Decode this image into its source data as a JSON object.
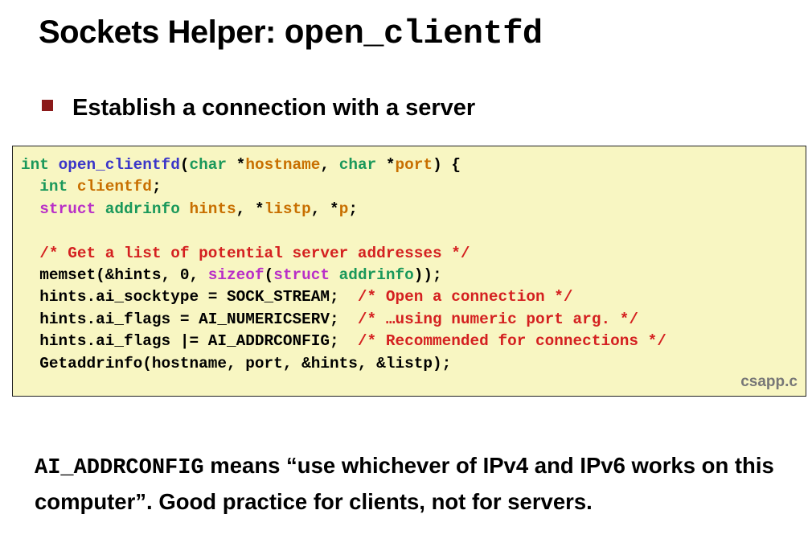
{
  "title": {
    "text": "Sockets Helper: ",
    "code": "open_clientfd"
  },
  "bullet": {
    "text": "Establish a connection with a server"
  },
  "code": {
    "filename": "csapp.c",
    "lines": [
      [
        {
          "t": "int",
          "c": "kw"
        },
        {
          "t": " ",
          "c": "pl"
        },
        {
          "t": "open_clientfd",
          "c": "fn"
        },
        {
          "t": "(",
          "c": "pl"
        },
        {
          "t": "char",
          "c": "kw"
        },
        {
          "t": " *",
          "c": "pl"
        },
        {
          "t": "hostname",
          "c": "var"
        },
        {
          "t": ", ",
          "c": "pl"
        },
        {
          "t": "char",
          "c": "kw"
        },
        {
          "t": " *",
          "c": "pl"
        },
        {
          "t": "port",
          "c": "var"
        },
        {
          "t": ") {",
          "c": "pl"
        }
      ],
      [
        {
          "t": "  ",
          "c": "pl"
        },
        {
          "t": "int",
          "c": "kw"
        },
        {
          "t": " ",
          "c": "pl"
        },
        {
          "t": "clientfd",
          "c": "var"
        },
        {
          "t": ";",
          "c": "pl"
        }
      ],
      [
        {
          "t": "  ",
          "c": "pl"
        },
        {
          "t": "struct",
          "c": "kwp"
        },
        {
          "t": " ",
          "c": "pl"
        },
        {
          "t": "addrinfo",
          "c": "kw"
        },
        {
          "t": " ",
          "c": "pl"
        },
        {
          "t": "hints",
          "c": "var"
        },
        {
          "t": ", *",
          "c": "pl"
        },
        {
          "t": "listp",
          "c": "var"
        },
        {
          "t": ", *",
          "c": "pl"
        },
        {
          "t": "p",
          "c": "var"
        },
        {
          "t": ";",
          "c": "pl"
        }
      ],
      [],
      [
        {
          "t": "  ",
          "c": "pl"
        },
        {
          "t": "/* Get a list of potential server addresses */",
          "c": "cm"
        }
      ],
      [
        {
          "t": "  memset(&hints, 0, ",
          "c": "pl"
        },
        {
          "t": "sizeof",
          "c": "kwp"
        },
        {
          "t": "(",
          "c": "pl"
        },
        {
          "t": "struct",
          "c": "kwp"
        },
        {
          "t": " ",
          "c": "pl"
        },
        {
          "t": "addrinfo",
          "c": "kw"
        },
        {
          "t": "));",
          "c": "pl"
        }
      ],
      [
        {
          "t": "  hints.ai_socktype = SOCK_STREAM;  ",
          "c": "pl"
        },
        {
          "t": "/* Open a connection */",
          "c": "cm"
        }
      ],
      [
        {
          "t": "  hints.ai_flags = AI_NUMERICSERV;  ",
          "c": "pl"
        },
        {
          "t": "/* …using numeric port arg. */",
          "c": "cm"
        }
      ],
      [
        {
          "t": "  hints.ai_flags |= AI_ADDRCONFIG;  ",
          "c": "pl"
        },
        {
          "t": "/* Recommended for connections */",
          "c": "cm"
        }
      ],
      [
        {
          "t": "  Getaddrinfo(hostname, port, &hints, &listp);",
          "c": "pl"
        }
      ]
    ]
  },
  "note": {
    "code": "AI_ADDRCONFIG",
    "text": " means “use whichever of IPv4 and IPv6 works on this computer”.  Good practice for clients, not for servers."
  }
}
